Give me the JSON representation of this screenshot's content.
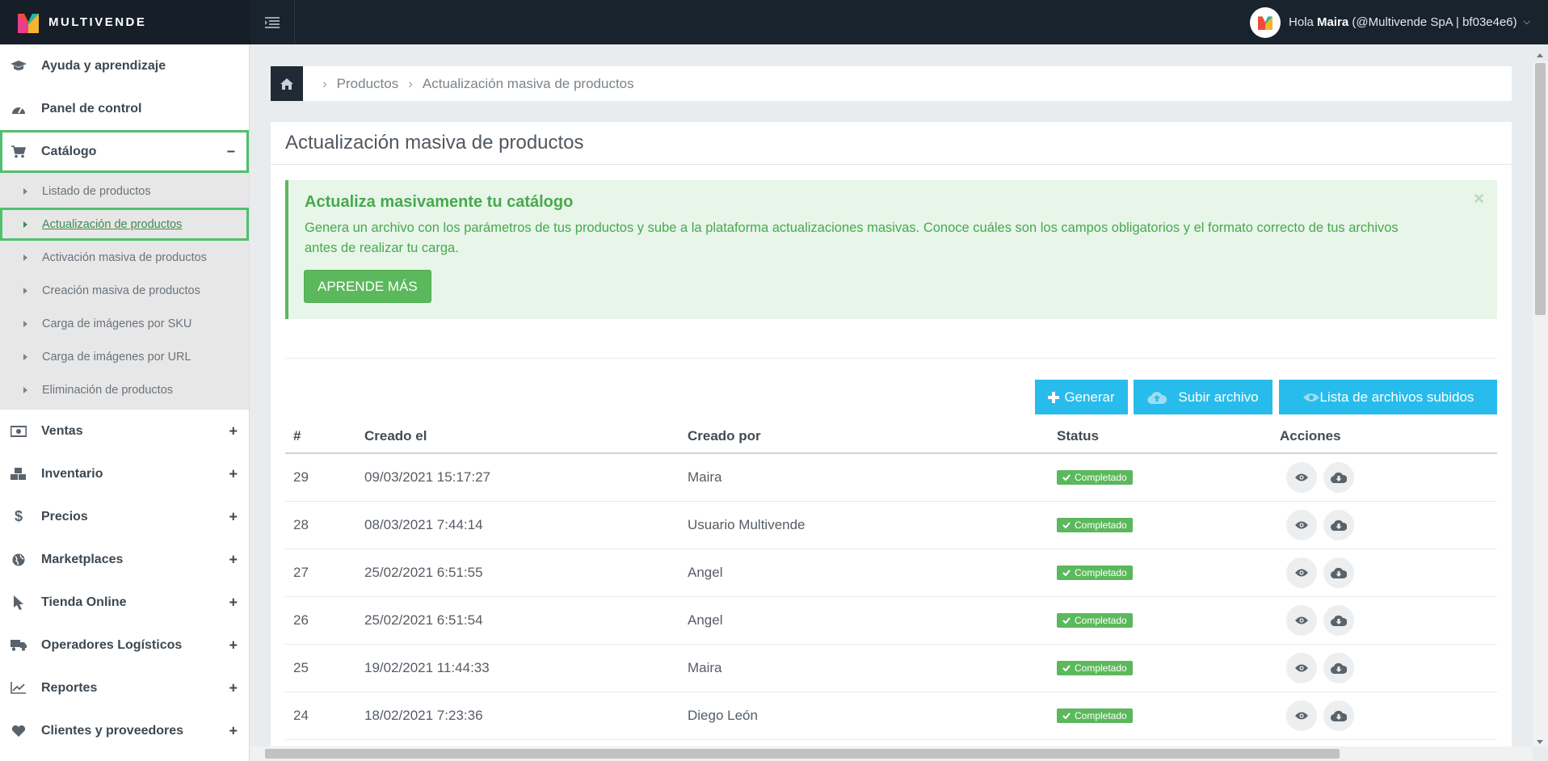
{
  "brand": {
    "name": "MULTIVENDE"
  },
  "user": {
    "greeting": "Hola",
    "name": "Maira",
    "account": "(@Multivende SpA | bf03e4e6)"
  },
  "sidebar": {
    "items": [
      {
        "label": "Ayuda y aprendizaje",
        "icon": "graduation-cap-icon"
      },
      {
        "label": "Panel de control",
        "icon": "dashboard-icon"
      },
      {
        "label": "Catálogo",
        "icon": "cart-icon",
        "toggle": "−",
        "active": true
      },
      {
        "label": "Ventas",
        "icon": "money-icon",
        "toggle": "+"
      },
      {
        "label": "Inventario",
        "icon": "cubes-icon",
        "toggle": "+"
      },
      {
        "label": "Precios",
        "icon": "dollar-icon",
        "toggle": "+"
      },
      {
        "label": "Marketplaces",
        "icon": "globe-icon",
        "toggle": "+"
      },
      {
        "label": "Tienda Online",
        "icon": "pointer-icon",
        "toggle": "+"
      },
      {
        "label": "Operadores Logísticos",
        "icon": "truck-icon",
        "toggle": "+"
      },
      {
        "label": "Reportes",
        "icon": "line-chart-icon",
        "toggle": "+"
      },
      {
        "label": "Clientes y proveedores",
        "icon": "heart-icon",
        "toggle": "+"
      }
    ],
    "catalog_subitems": [
      "Listado de productos",
      "Actualización de productos",
      "Activación masiva de productos",
      "Creación masiva de productos",
      "Carga de imágenes por SKU",
      "Carga de imágenes por URL",
      "Eliminación de productos"
    ]
  },
  "breadcrumb": {
    "items": [
      "Productos",
      "Actualización masiva de productos"
    ]
  },
  "panel": {
    "title": "Actualización masiva de productos"
  },
  "alert": {
    "title": "Actualiza masivamente tu catálogo",
    "text": "Genera un archivo con los parámetros de tus productos y sube a la plataforma actualizaciones masivas. Conoce cuáles son los campos obligatorios y el formato correcto de tus archivos antes de realizar tu carga.",
    "button": "APRENDE MÁS",
    "close": "×"
  },
  "actions": {
    "generate": "Generar",
    "upload": "Subir archivo",
    "list": "Lista de archivos subidos"
  },
  "table": {
    "headers": [
      "#",
      "Creado el",
      "Creado por",
      "Status",
      "Acciones"
    ],
    "rows": [
      {
        "num": "29",
        "created_at": "09/03/2021 15:17:27",
        "created_by": "Maira",
        "status": "Completado"
      },
      {
        "num": "28",
        "created_at": "08/03/2021 7:44:14",
        "created_by": "Usuario Multivende",
        "status": "Completado"
      },
      {
        "num": "27",
        "created_at": "25/02/2021 6:51:55",
        "created_by": "Angel",
        "status": "Completado"
      },
      {
        "num": "26",
        "created_at": "25/02/2021 6:51:54",
        "created_by": "Angel",
        "status": "Completado"
      },
      {
        "num": "25",
        "created_at": "19/02/2021 11:44:33",
        "created_by": "Maira",
        "status": "Completado"
      },
      {
        "num": "24",
        "created_at": "18/02/2021 7:23:36",
        "created_by": "Diego León",
        "status": "Completado"
      }
    ]
  },
  "colors": {
    "accent_green": "#5cb85c",
    "action_blue": "#27bcec",
    "topbar": "#19232d",
    "highlight": "#4fc06d"
  }
}
